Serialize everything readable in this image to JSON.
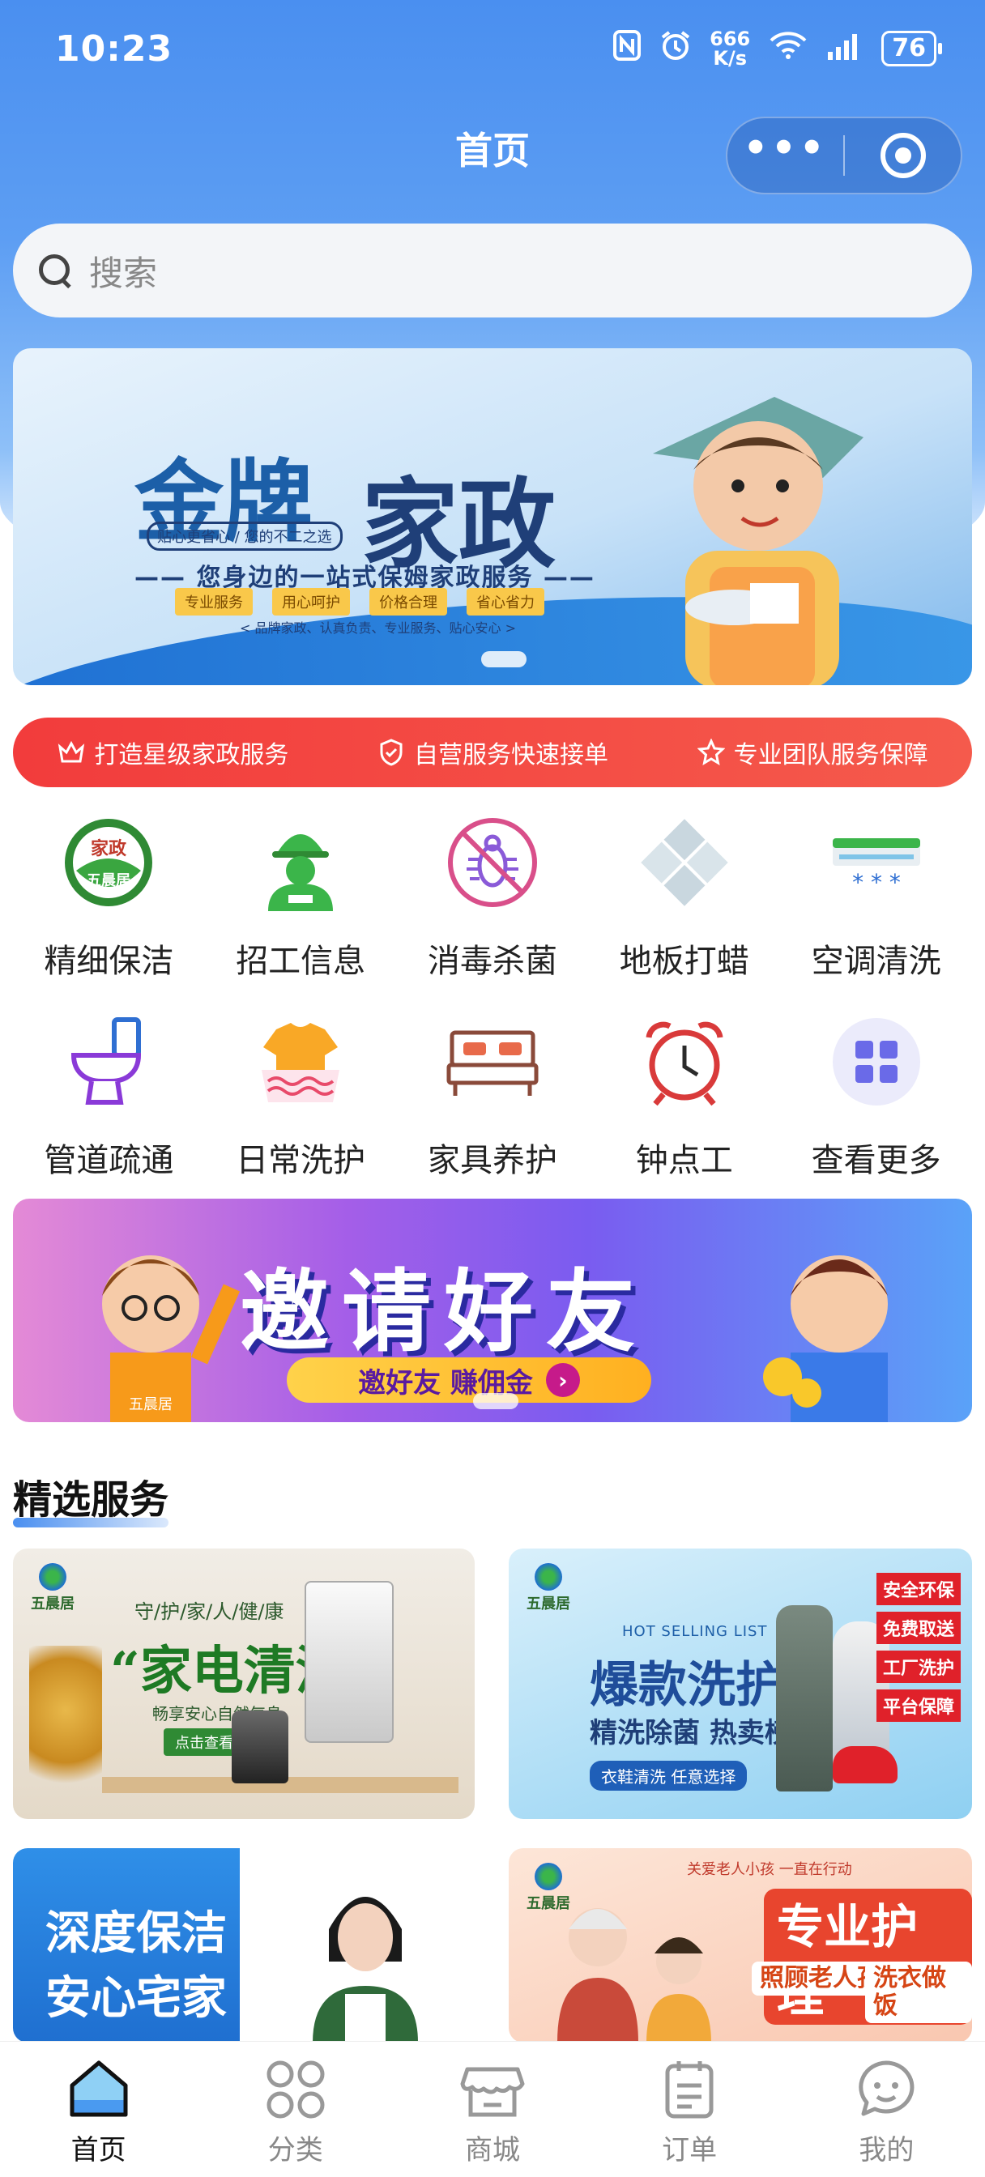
{
  "status_bar": {
    "time": "10:23",
    "speed_value": "666",
    "speed_unit": "K/s",
    "battery": "76"
  },
  "nav": {
    "title": "首页"
  },
  "search": {
    "placeholder": "搜索"
  },
  "hero_banner": {
    "title_part1": "金牌",
    "title_part2": "家政",
    "slogan": "贴心更省心 / 您的不二之选",
    "subtitle": "—— 您身边的一站式保姆家政服务 ——",
    "tags": [
      "专业服务",
      "用心呵护",
      "价格合理",
      "省心省力"
    ],
    "footer": "< 品牌家政、认真负责、专业服务、贴心安心 >"
  },
  "promise_bar": {
    "items": [
      {
        "label": "打造星级家政服务",
        "icon": "crown-icon"
      },
      {
        "label": "自营服务快速接单",
        "icon": "shield-check-icon"
      },
      {
        "label": "专业团队服务保障",
        "icon": "star-icon"
      }
    ]
  },
  "categories": [
    {
      "label": "精细保洁",
      "icon": "housekeeping-logo-icon",
      "logo_text_top": "家政",
      "logo_text_bottom": "五晨居"
    },
    {
      "label": "招工信息",
      "icon": "worker-helmet-icon"
    },
    {
      "label": "消毒杀菌",
      "icon": "no-bug-icon"
    },
    {
      "label": "地板打蜡",
      "icon": "floor-tiles-icon"
    },
    {
      "label": "空调清洗",
      "icon": "air-conditioner-icon"
    },
    {
      "label": "管道疏通",
      "icon": "toilet-icon"
    },
    {
      "label": "日常洗护",
      "icon": "shirt-wash-icon"
    },
    {
      "label": "家具养护",
      "icon": "bed-icon"
    },
    {
      "label": "钟点工",
      "icon": "alarm-clock-icon"
    },
    {
      "label": "查看更多",
      "icon": "grid-more-icon"
    }
  ],
  "invite_banner": {
    "title": "邀请好友",
    "button_label": "邀好友 赚佣金",
    "brand": "五晨居"
  },
  "section": {
    "title": "精选服务"
  },
  "service_cards": [
    {
      "brand": "五晨居",
      "tagline": "守/护/家/人/健/康",
      "title": "“家电清洗”",
      "subtitle": "畅享安心自然气息",
      "button": "点击查看"
    },
    {
      "brand": "五晨居",
      "eyebrow": "HOT SELLING LIST",
      "title": "爆款洗护",
      "subtitle": "精洗除菌 热卖榜",
      "tagline": "衣鞋清洗 任意选择",
      "badges": [
        "安全环保",
        "免费取送",
        "工厂洗护",
        "平台保障"
      ]
    },
    {
      "line1": "深度保洁",
      "line2": "安心宅家"
    },
    {
      "brand": "五晨居",
      "top": "关爱老人小孩 一直在行动",
      "title": "专业护理",
      "badge_left": "照顾老人孩子",
      "badge_right": "洗衣做饭"
    }
  ],
  "tab_bar": {
    "items": [
      {
        "label": "首页",
        "icon": "home-icon",
        "active": true
      },
      {
        "label": "分类",
        "icon": "category-icon",
        "active": false
      },
      {
        "label": "商城",
        "icon": "shop-icon",
        "active": false
      },
      {
        "label": "订单",
        "icon": "order-icon",
        "active": false
      },
      {
        "label": "我的",
        "icon": "chat-profile-icon",
        "active": false
      }
    ]
  },
  "colors": {
    "primary_blue": "#4a8ff0",
    "promise_red": "#f23c3c",
    "text_dark": "#222222",
    "tab_inactive": "#888888"
  }
}
